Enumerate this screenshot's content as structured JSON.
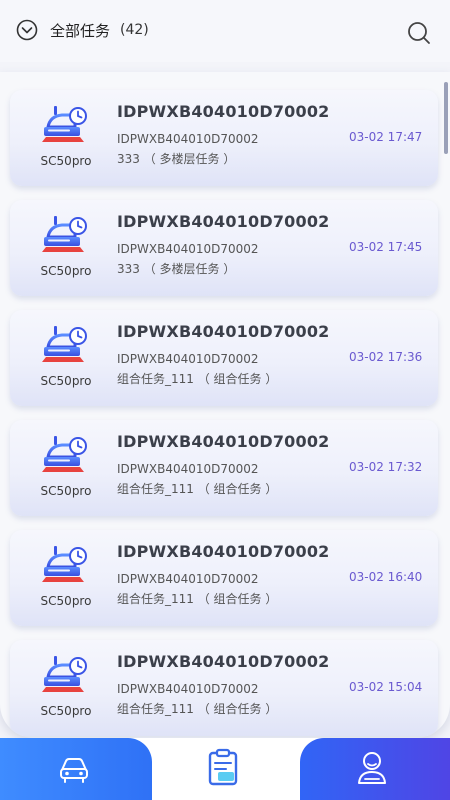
{
  "header": {
    "filter_label": "全部任务",
    "filter_count": "(42)",
    "icons": [
      "chevron-down-circle-icon",
      "search-icon"
    ]
  },
  "tasks": [
    {
      "title": "IDPWXB404010D70002",
      "subtitle": "IDPWXB404010D70002",
      "type": "333 （ 多楼层任务 ）",
      "time": "03-02 17:47",
      "model": "SC50pro"
    },
    {
      "title": "IDPWXB404010D70002",
      "subtitle": "IDPWXB404010D70002",
      "type": "333 （ 多楼层任务 ）",
      "time": "03-02 17:45",
      "model": "SC50pro"
    },
    {
      "title": "IDPWXB404010D70002",
      "subtitle": "IDPWXB404010D70002",
      "type": "组合任务_111 （ 组合任务 ）",
      "time": "03-02 17:36",
      "model": "SC50pro"
    },
    {
      "title": "IDPWXB404010D70002",
      "subtitle": "IDPWXB404010D70002",
      "type": "组合任务_111 （ 组合任务 ）",
      "time": "03-02 17:32",
      "model": "SC50pro"
    },
    {
      "title": "IDPWXB404010D70002",
      "subtitle": "IDPWXB404010D70002",
      "type": "组合任务_111 （ 组合任务 ）",
      "time": "03-02 16:40",
      "model": "SC50pro"
    },
    {
      "title": "IDPWXB404010D70002",
      "subtitle": "IDPWXB404010D70002",
      "type": "组合任务_111 （ 组合任务 ）",
      "time": "03-02 15:04",
      "model": "SC50pro"
    }
  ],
  "tabbar": {
    "tabs": [
      {
        "icon": "robot-car-icon",
        "active": false
      },
      {
        "icon": "clipboard-task-icon",
        "active": true
      },
      {
        "icon": "user-profile-icon",
        "active": false
      }
    ]
  },
  "colors": {
    "accent": "#2f71f6",
    "time_text": "#6a5ad0",
    "tab_gradient_left": "#3f8cff",
    "tab_gradient_right": "#4f45e5"
  }
}
